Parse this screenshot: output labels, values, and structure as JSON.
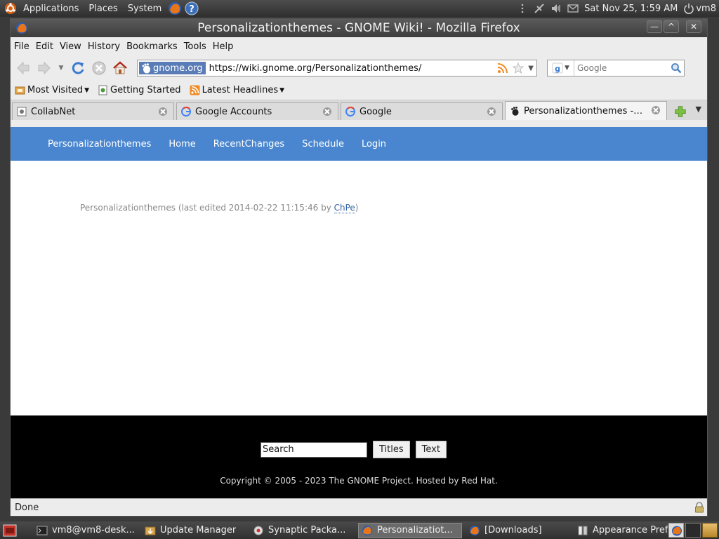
{
  "top_panel": {
    "menus": [
      "Applications",
      "Places",
      "System"
    ],
    "clock": "Sat Nov 25,  1:59 AM",
    "user": "vm8"
  },
  "window": {
    "title": "Personalizationthemes - GNOME Wiki! - Mozilla Firefox"
  },
  "menubar": [
    "File",
    "Edit",
    "View",
    "History",
    "Bookmarks",
    "Tools",
    "Help"
  ],
  "navbar": {
    "site_identity": "gnome.org",
    "url": "https://wiki.gnome.org/Personalizationthemes/",
    "search_placeholder": "Google"
  },
  "bookmarks": [
    {
      "label": "Most Visited",
      "icon": "bookmarks-folder-icon"
    },
    {
      "label": "Getting Started",
      "icon": "page-icon"
    },
    {
      "label": "Latest Headlines",
      "icon": "rss-icon"
    }
  ],
  "tabs": [
    {
      "label": "CollabNet",
      "icon": "page-icon"
    },
    {
      "label": "Google Accounts",
      "icon": "google-icon"
    },
    {
      "label": "Google",
      "icon": "google-icon"
    },
    {
      "label": "Personalizationthemes - G...",
      "icon": "gnome-foot-icon",
      "active": true
    }
  ],
  "wiki": {
    "nav": [
      "Personalizationthemes",
      "Home",
      "RecentChanges",
      "Schedule",
      "Login"
    ],
    "last_edited_prefix": "Personalizationthemes (last edited 2014-02-22 11:15:46 by ",
    "last_edited_author": "ChPe",
    "last_edited_suffix": ")",
    "search_value": "Search",
    "titles_button": "Titles",
    "text_button": "Text",
    "copyright": "Copyright © 2005 - 2023 The GNOME Project. Hosted by Red Hat.",
    "colors": {
      "nav_bg": "#4a86cf",
      "footer_bg": "#000000"
    }
  },
  "status": "Done",
  "taskbar": [
    {
      "label": "vm8@vm8-desk...",
      "icon": "terminal-icon"
    },
    {
      "label": "Update Manager",
      "icon": "update-manager-icon"
    },
    {
      "label": "Synaptic Packa...",
      "icon": "synaptic-icon"
    },
    {
      "label": "Personalizatiot...",
      "icon": "firefox-icon",
      "active": true
    },
    {
      "label": "[Downloads]",
      "icon": "firefox-icon"
    },
    {
      "label": "Appearance Pref...",
      "icon": "appearance-icon"
    }
  ]
}
